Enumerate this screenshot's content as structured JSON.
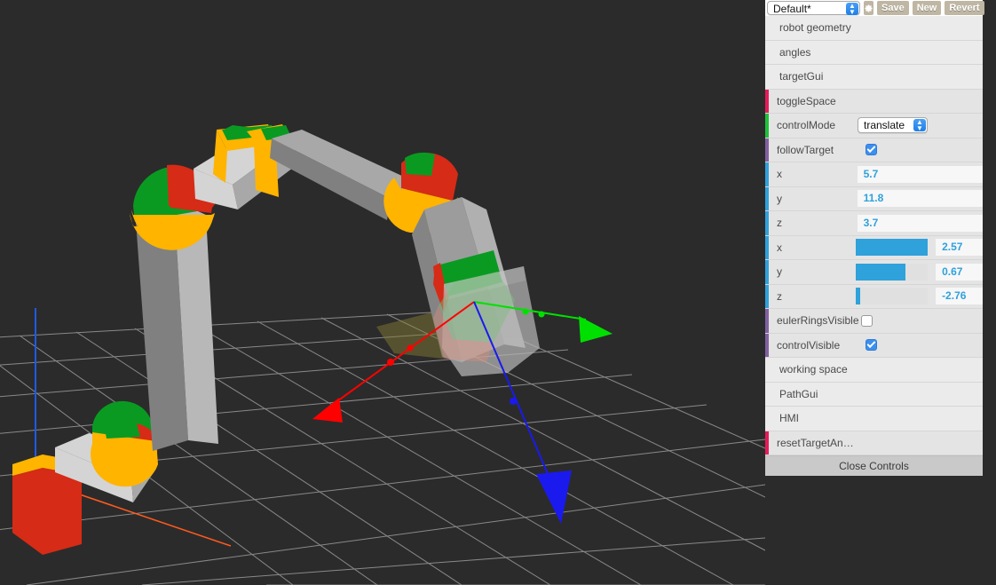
{
  "header": {
    "preset_value": "Default*",
    "gear_icon": "gear-icon",
    "buttons": [
      {
        "name": "save-button",
        "label": "Save"
      },
      {
        "name": "new-button",
        "label": "New"
      },
      {
        "name": "revert-button",
        "label": "Revert"
      }
    ]
  },
  "rows": [
    {
      "type": "folder",
      "name": "folder-robot-geometry",
      "label": "robot geometry",
      "strip": "none"
    },
    {
      "type": "folder",
      "name": "folder-angles",
      "label": "angles",
      "strip": "none"
    },
    {
      "type": "folder",
      "name": "folder-target-gui",
      "label": "targetGui",
      "strip": "none"
    },
    {
      "type": "button",
      "name": "control-toggle-space",
      "label": "toggleSpace",
      "strip": "#e61a5a"
    },
    {
      "type": "select",
      "name": "control-mode-select",
      "label": "controlMode",
      "strip": "#1cc23a",
      "value": "translate"
    },
    {
      "type": "checkbox",
      "name": "control-follow-target",
      "label": "followTarget",
      "strip": "#8061a0",
      "checked": true
    },
    {
      "type": "number",
      "name": "control-x-position",
      "label": "x",
      "strip": "#2fa1db",
      "value": "5.7"
    },
    {
      "type": "number",
      "name": "control-y-position",
      "label": "y",
      "strip": "#2fa1db",
      "value": "11.8"
    },
    {
      "type": "number",
      "name": "control-z-position",
      "label": "z",
      "strip": "#2fa1db",
      "value": "3.7"
    },
    {
      "type": "slider",
      "name": "control-x-rotation",
      "label": "x",
      "strip": "#2fa1db",
      "value": "2.57",
      "fill_pct": 100
    },
    {
      "type": "slider",
      "name": "control-y-rotation",
      "label": "y",
      "strip": "#2fa1db",
      "value": "0.67",
      "fill_pct": 69
    },
    {
      "type": "slider",
      "name": "control-z-rotation",
      "label": "z",
      "strip": "#2fa1db",
      "value": "-2.76",
      "fill_pct": 6
    },
    {
      "type": "checkbox",
      "name": "control-euler-rings-visible",
      "label": "eulerRingsVisible",
      "strip": "#8061a0",
      "checked": false
    },
    {
      "type": "checkbox",
      "name": "control-visible",
      "label": "controlVisible",
      "strip": "#8061a0",
      "checked": true
    },
    {
      "type": "folder",
      "name": "folder-working-space",
      "label": "working space",
      "strip": "none"
    },
    {
      "type": "folder",
      "name": "folder-path-gui",
      "label": "PathGui",
      "strip": "none"
    },
    {
      "type": "folder",
      "name": "folder-hmi",
      "label": "HMI",
      "strip": "none"
    },
    {
      "type": "button",
      "name": "control-reset-target-angles",
      "label": "resetTargetAn…",
      "strip": "#e61a5a"
    }
  ],
  "footer": {
    "close_label": "Close Controls"
  },
  "viewport": {
    "name": "robot-arm-3d-viewport",
    "background": "#2b2b2b",
    "grid_color": "#9a9a9a",
    "axis_colors": {
      "x": "#ff5a1e",
      "y": "#1e5ae6",
      "z": "#9a9a9a"
    },
    "gizmo": {
      "mode": "translate",
      "arrow_x_color": "#ff0000",
      "arrow_y_color": "#00e000",
      "arrow_z_color": "#0000ee"
    },
    "robot": {
      "link_color_light": "#d4d4d4",
      "link_color_mid": "#a8a8a8",
      "link_color_dark": "#808080",
      "joint_colors": [
        "#d62b16",
        "#0a9a22",
        "#ffb400"
      ]
    }
  }
}
